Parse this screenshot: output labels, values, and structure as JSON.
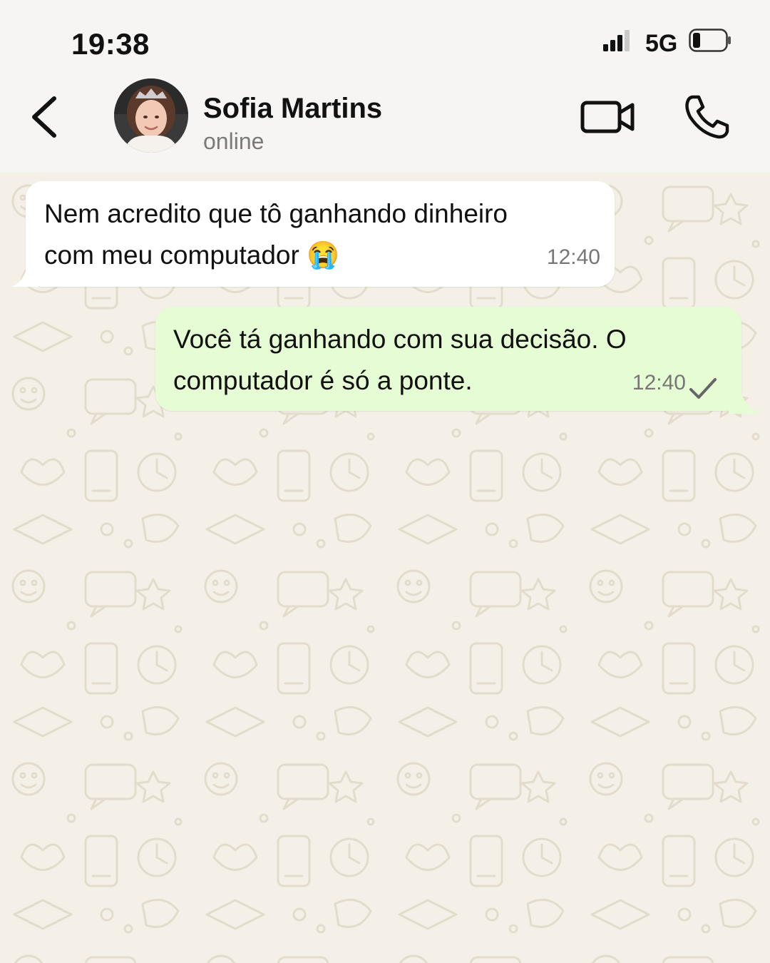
{
  "status_bar": {
    "time": "19:38",
    "network": "5G"
  },
  "contact": {
    "name": "Sofia Martins",
    "status": "online"
  },
  "messages": [
    {
      "direction": "incoming",
      "text": "Nem acredito que tô ganhando dinheiro\ncom meu computador 😭",
      "time": "12:40"
    },
    {
      "direction": "outgoing",
      "text": "Você tá ganhando com sua decisão. O\ncomputador é só a ponte.",
      "time": "12:40",
      "receipt": "single-check-icon"
    }
  ],
  "colors": {
    "incoming_bubble": "#ffffff",
    "outgoing_bubble": "#e6fcd5",
    "chat_background": "#f4f0e7",
    "header": "#f6f5f3"
  }
}
